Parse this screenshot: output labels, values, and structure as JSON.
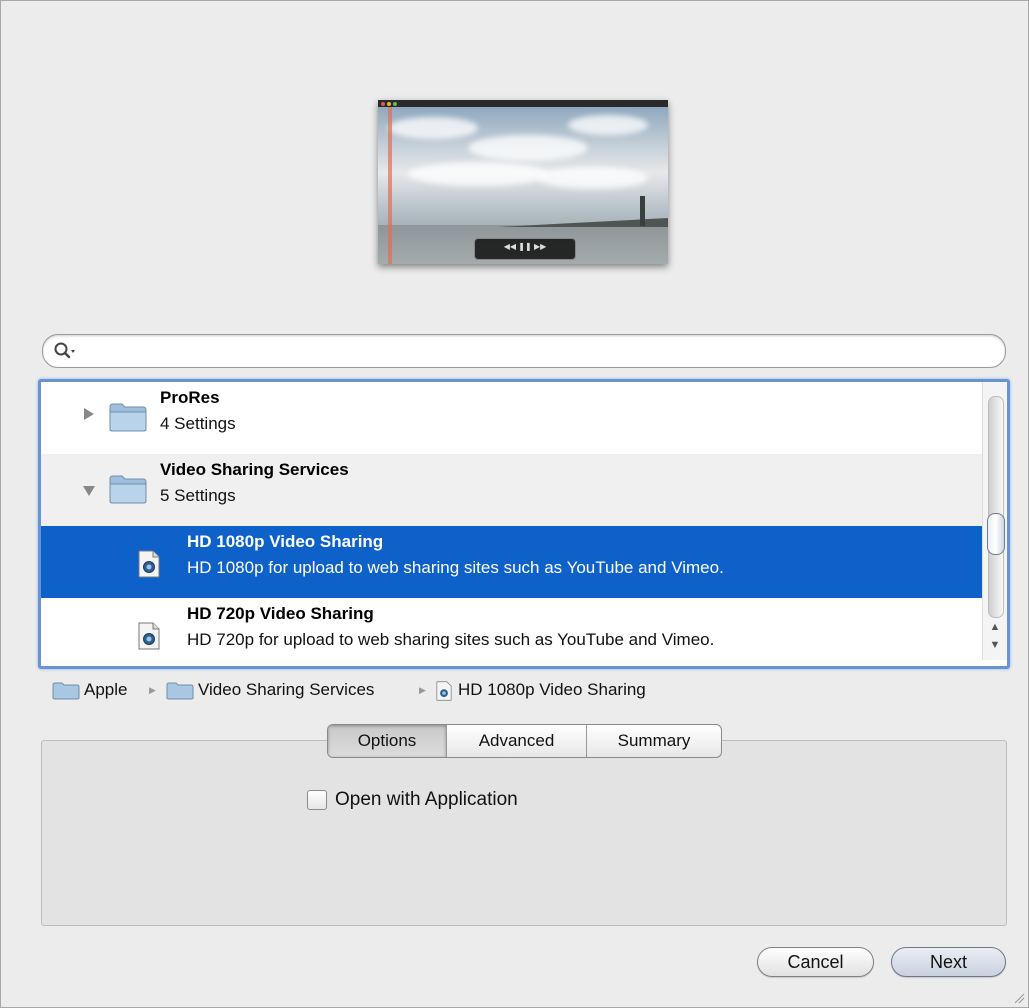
{
  "search": {
    "value": "",
    "placeholder": ""
  },
  "list": {
    "rows": [
      {
        "title": "ProRes",
        "subtitle": "4 Settings",
        "kind": "folder",
        "expanded": false
      },
      {
        "title": "Video Sharing Services",
        "subtitle": "5 Settings",
        "kind": "folder",
        "expanded": true
      },
      {
        "title": "HD 1080p Video Sharing",
        "subtitle": "HD 1080p for upload to web sharing sites such as YouTube and Vimeo.",
        "kind": "setting",
        "selected": true
      },
      {
        "title": "HD 720p Video Sharing",
        "subtitle": "HD 720p for upload to web sharing sites such as YouTube and Vimeo.",
        "kind": "setting",
        "selected": false
      }
    ]
  },
  "breadcrumb": {
    "items": [
      "Apple",
      "Video Sharing Services",
      "HD 1080p Video Sharing"
    ]
  },
  "tabs": {
    "items": [
      "Options",
      "Advanced",
      "Summary"
    ],
    "active": "Options"
  },
  "options": {
    "open_with_application_label": "Open with Application",
    "open_with_application_checked": false
  },
  "buttons": {
    "cancel": "Cancel",
    "next": "Next"
  },
  "colors": {
    "selection": "#0e61c9",
    "focus_ring": "#6a93d6",
    "window_bg": "#ececec"
  }
}
